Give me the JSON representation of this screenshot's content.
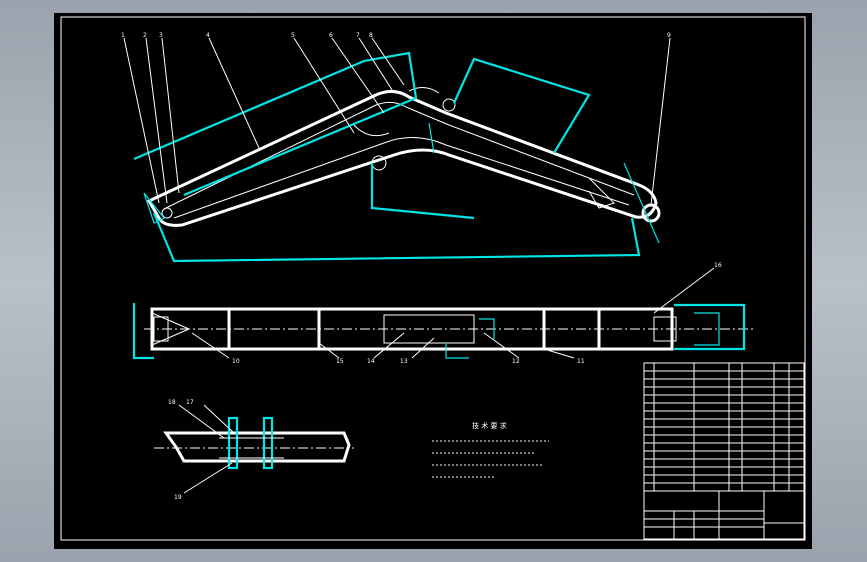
{
  "drawing": {
    "callouts": [
      "1",
      "2",
      "3",
      "4",
      "5",
      "6",
      "7",
      "8",
      "9"
    ],
    "plan_callouts": [
      "10",
      "11",
      "12",
      "13",
      "14",
      "15",
      "16"
    ],
    "detail_callouts": [
      "17",
      "18",
      "19"
    ],
    "notes_title": "技 术 要 求"
  }
}
